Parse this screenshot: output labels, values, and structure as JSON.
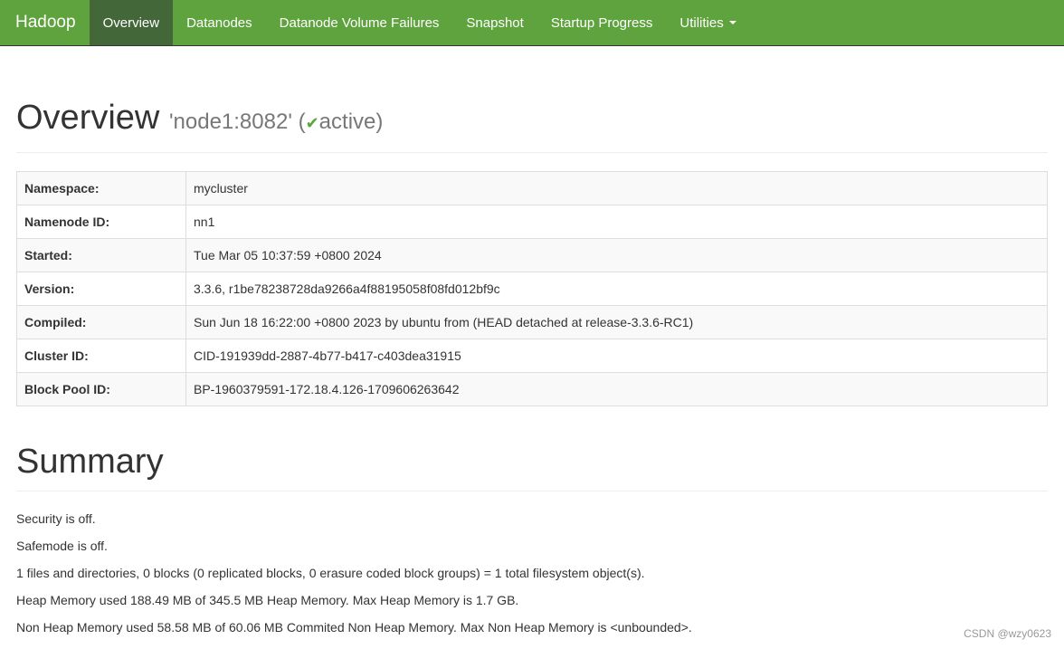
{
  "nav": {
    "brand": "Hadoop",
    "items": [
      "Overview",
      "Datanodes",
      "Datanode Volume Failures",
      "Snapshot",
      "Startup Progress",
      "Utilities"
    ]
  },
  "header": {
    "title": "Overview",
    "node": "'node1:8082'",
    "open": "(",
    "check": "✔",
    "state": "active",
    "close": ")"
  },
  "info": [
    {
      "label": "Namespace:",
      "value": "mycluster"
    },
    {
      "label": "Namenode ID:",
      "value": "nn1"
    },
    {
      "label": "Started:",
      "value": "Tue Mar 05 10:37:59 +0800 2024"
    },
    {
      "label": "Version:",
      "value": "3.3.6, r1be78238728da9266a4f88195058f08fd012bf9c"
    },
    {
      "label": "Compiled:",
      "value": "Sun Jun 18 16:22:00 +0800 2023 by ubuntu from (HEAD detached at release-3.3.6-RC1)"
    },
    {
      "label": "Cluster ID:",
      "value": "CID-191939dd-2887-4b77-b417-c403dea31915"
    },
    {
      "label": "Block Pool ID:",
      "value": "BP-1960379591-172.18.4.126-1709606263642"
    }
  ],
  "summary": {
    "title": "Summary",
    "lines": [
      "Security is off.",
      "Safemode is off.",
      "1 files and directories, 0 blocks (0 replicated blocks, 0 erasure coded block groups) = 1 total filesystem object(s).",
      "Heap Memory used 188.49 MB of 345.5 MB Heap Memory. Max Heap Memory is 1.7 GB.",
      "Non Heap Memory used 58.58 MB of 60.06 MB Commited Non Heap Memory. Max Non Heap Memory is <unbounded>."
    ]
  },
  "watermark": "CSDN @wzy0623"
}
